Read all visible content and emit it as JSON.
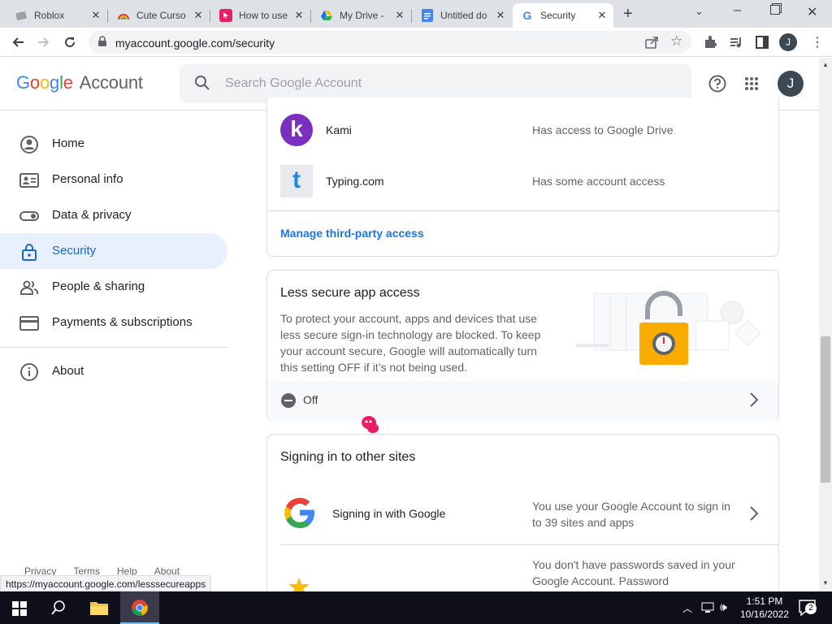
{
  "tabs": [
    {
      "title": "Roblox"
    },
    {
      "title": "Cute Curso"
    },
    {
      "title": "How to use"
    },
    {
      "title": "My Drive -"
    },
    {
      "title": "Untitled do"
    },
    {
      "title": "Security"
    }
  ],
  "url": "myaccount.google.com/security",
  "profile_initial": "J",
  "header": {
    "logo_google": "Google",
    "logo_account": "Account",
    "search_placeholder": "Search Google Account"
  },
  "sidebar": {
    "items": [
      {
        "label": "Home"
      },
      {
        "label": "Personal info"
      },
      {
        "label": "Data & privacy"
      },
      {
        "label": "Security"
      },
      {
        "label": "People & sharing"
      },
      {
        "label": "Payments & subscriptions"
      },
      {
        "label": "About"
      }
    ],
    "footer": [
      "Privacy",
      "Terms",
      "Help",
      "About"
    ]
  },
  "third_party": {
    "apps": [
      {
        "name": "Kami",
        "access": "Has access to Google Drive",
        "icon_letter": "k"
      },
      {
        "name": "Typing.com",
        "access": "Has some account access",
        "icon_letter": "t"
      }
    ],
    "manage_link": "Manage third-party access"
  },
  "less_secure": {
    "title": "Less secure app access",
    "description": "To protect your account, apps and devices that use less secure sign-in technology are blocked. To keep your account secure, Google will automatically turn this setting OFF if it’s not being used.",
    "status": "Off"
  },
  "other_sites": {
    "title": "Signing in to other sites",
    "rows": [
      {
        "name": "Signing in with Google",
        "detail": "You use your Google Account to sign in to 39 sites and apps"
      },
      {
        "name": "",
        "detail": "You don't have passwords saved in your Google Account. Password"
      }
    ]
  },
  "status_url": "https://myaccount.google.com/lesssecureapps",
  "taskbar": {
    "time": "1:51 PM",
    "date": "10/16/2022",
    "notifications": "2"
  },
  "colors": {
    "accent": "#1a73e8",
    "kami": "#7b2fbe",
    "typing": "#1e88e5",
    "taskbar": "#0f0f1a"
  }
}
